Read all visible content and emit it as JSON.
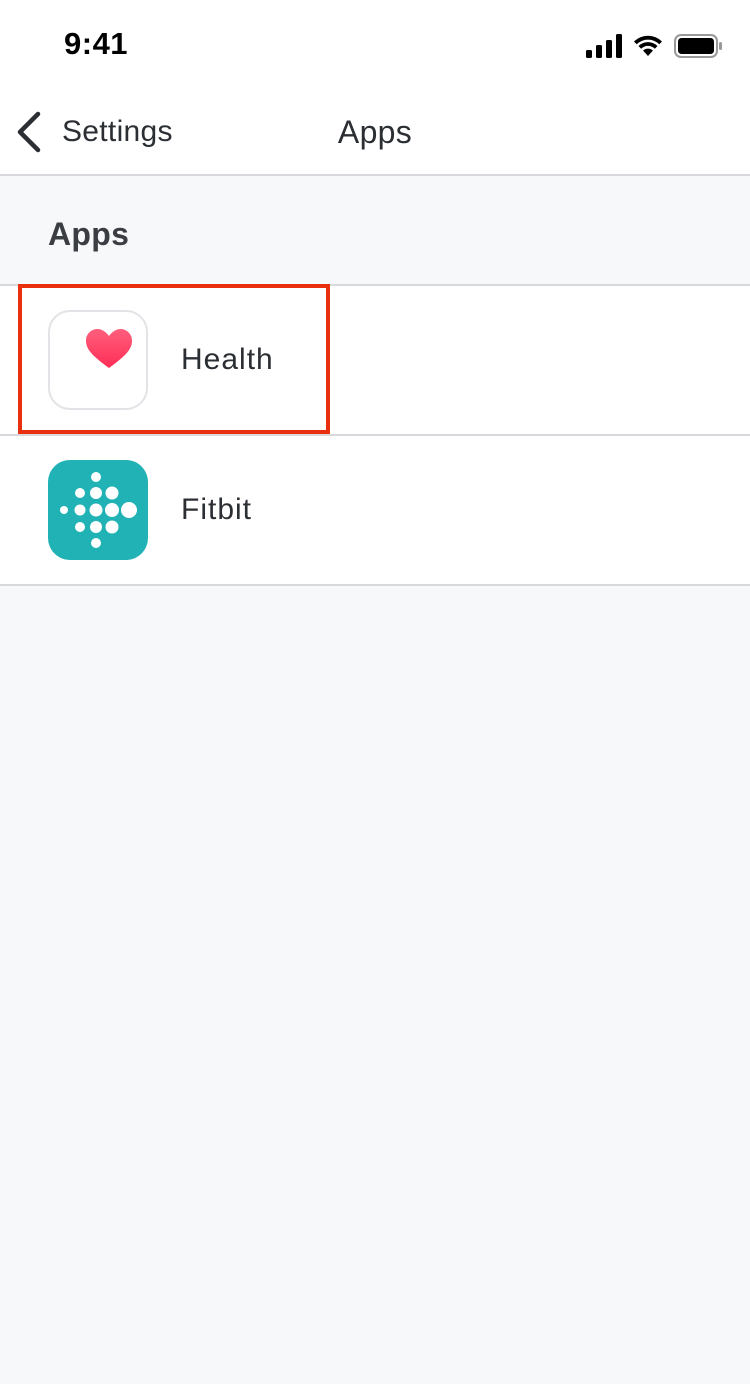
{
  "status_bar": {
    "time": "9:41",
    "icons": [
      "signal-icon",
      "wifi-icon",
      "battery-icon"
    ]
  },
  "nav": {
    "back_label": "Settings",
    "title": "Apps"
  },
  "section": {
    "title": "Apps"
  },
  "apps": [
    {
      "name": "Health",
      "icon": "health-heart-icon",
      "highlighted": true
    },
    {
      "name": "Fitbit",
      "icon": "fitbit-logo-icon",
      "highlighted": false
    }
  ],
  "colors": {
    "highlight": "#e8300f",
    "fitbit_bg": "#20b2b5",
    "heart": "#ff2d55",
    "divider": "#d7d9dd",
    "background": "#f7f8fa"
  }
}
